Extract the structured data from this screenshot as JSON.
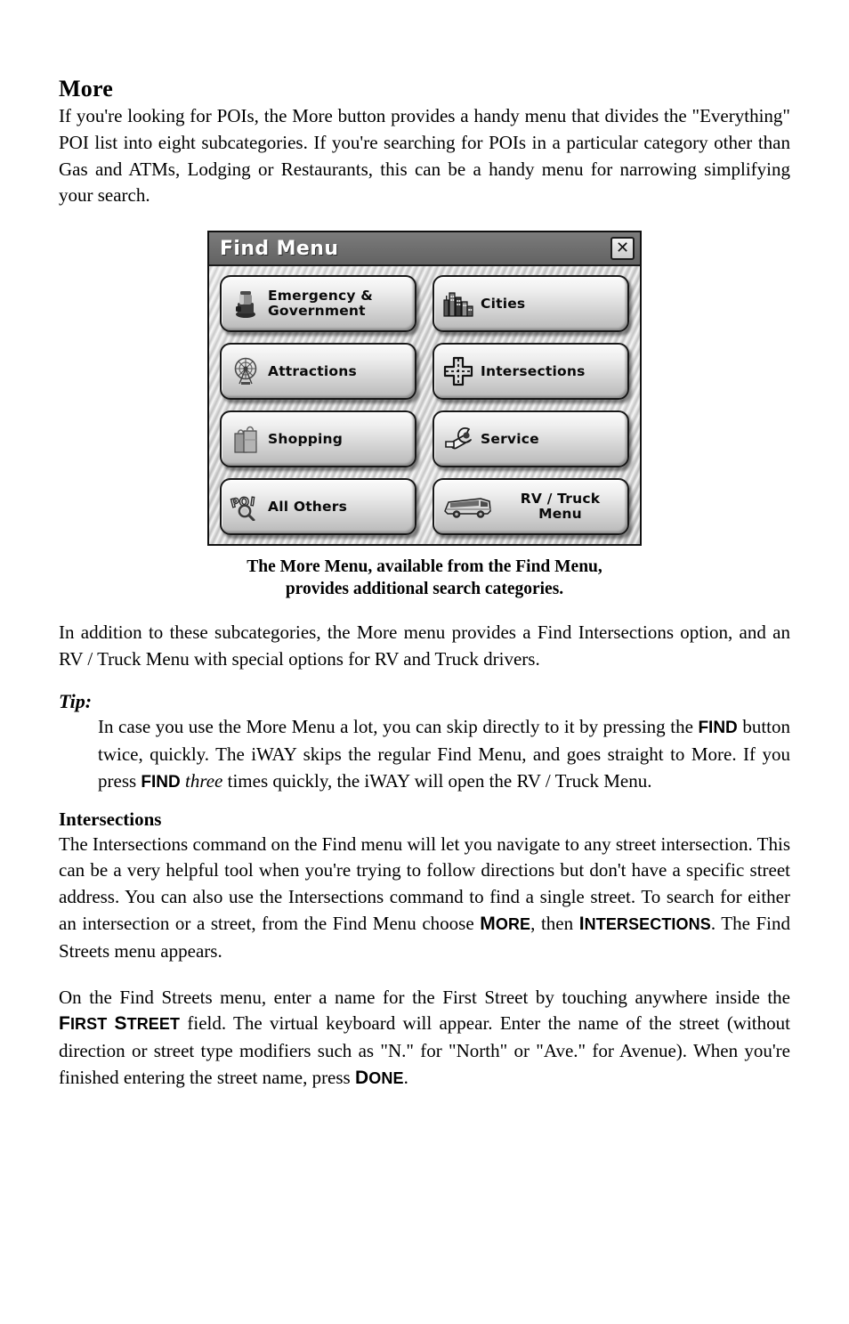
{
  "sections": {
    "more": {
      "heading": "More",
      "paragraph": "If you're looking for POIs, the More button provides a handy menu that divides the \"Everything\" POI list into eight subcategories. If you're searching for POIs in a particular category other than Gas and ATMs, Lodging or Restaurants, this can be a handy menu for narrowing simplifying your search."
    },
    "after_figure": {
      "paragraph": "In addition to these subcategories, the More menu provides a Find Intersections option, and an RV / Truck Menu with special options for RV and Truck drivers."
    },
    "tip": {
      "label": "Tip:",
      "part1": "In case you use the More Menu a lot, you can skip directly to it by pressing the ",
      "kbd1": "FIND",
      "part2": " button twice, quickly. The iWAY skips the regular Find Menu, and goes straight to More. If you press ",
      "kbd2": "FIND",
      "part3": " ",
      "italic1": "three",
      "part4": " times quickly, the iWAY will open the RV / Truck Menu."
    },
    "intersections": {
      "heading": "Intersections",
      "para1_part1": "The Intersections command on the Find menu will let you navigate to any street intersection. This can be a very helpful tool when you're trying to follow directions but don't have a specific street address. You can also use the Intersections command to find a single street. To search for either an intersection or a street, from the Find Menu choose ",
      "smallcaps1_cap": "M",
      "smallcaps1_rest": "ORE",
      "para1_part2": ", then ",
      "smallcaps2_cap": "I",
      "smallcaps2_rest": "NTERSECTIONS",
      "para1_part3": ". The Find Streets menu appears.",
      "para2_part1": "On the Find Streets menu, enter a name for the First Street by touching anywhere inside the ",
      "smallcaps3_cap": "F",
      "smallcaps3_rest": "IRST ",
      "smallcaps3_cap2": "S",
      "smallcaps3_rest2": "TREET",
      "para2_part2": " field. The virtual keyboard will appear. Enter the name of the street (without direction or street type modifiers such as \"N.\" for \"North\" or \"Ave.\" for Avenue). When you're finished entering the street name, press ",
      "smallcaps4_cap": "D",
      "smallcaps4_rest": "ONE",
      "para2_part3": "."
    }
  },
  "figure": {
    "device": {
      "title": "Find Menu",
      "close_label": "✕",
      "buttons": [
        {
          "label": "Emergency &\nGovernment",
          "icon": "siren-beacon-icon",
          "position": "row1-left"
        },
        {
          "label": "Cities",
          "icon": "city-skyline-icon",
          "position": "row1-right"
        },
        {
          "label": "Attractions",
          "icon": "ferris-wheel-icon",
          "position": "row2-left"
        },
        {
          "label": "Intersections",
          "icon": "crossroads-icon",
          "position": "row2-right"
        },
        {
          "label": "Shopping",
          "icon": "shopping-bags-icon",
          "position": "row3-left"
        },
        {
          "label": "Service",
          "icon": "wrench-icon",
          "position": "row3-right"
        },
        {
          "label": "All Others",
          "icon": "poi-magnifier-icon",
          "position": "row4-left"
        },
        {
          "label": "RV / Truck\nMenu",
          "icon": "rv-bus-icon",
          "position": "row4-right"
        }
      ]
    },
    "caption_line1": "The More Menu, available from the Find Menu,",
    "caption_line2": "provides additional search categories."
  },
  "colors": {
    "titlebar": "#6f6f6f",
    "panel_bg": "#d4d4d4",
    "button_face": "#e4e4e4",
    "text": "#000000"
  }
}
